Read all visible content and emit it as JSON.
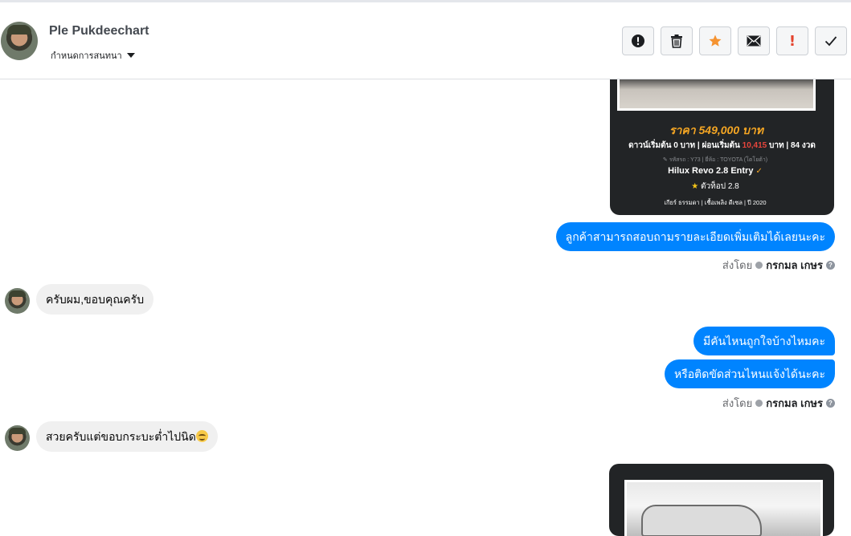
{
  "header": {
    "contact_name": "Ple Pukdeechart",
    "assign_label": "กำหนดการสนทนา",
    "toolbar": [
      {
        "name": "spam-button",
        "icon": "alert-circle-icon"
      },
      {
        "name": "delete-button",
        "icon": "trash-icon"
      },
      {
        "name": "star-button",
        "icon": "star-icon",
        "color": "#f59331"
      },
      {
        "name": "mark-unread-button",
        "icon": "envelope-icon"
      },
      {
        "name": "important-button",
        "icon": "exclamation-icon",
        "glyph": "!",
        "color": "#e4432d"
      },
      {
        "name": "done-button",
        "icon": "checkmark-icon"
      }
    ]
  },
  "car_card": {
    "price": "ราคา 549,000 บาท",
    "down_prefix": "ดาวน์เริ่มต้น 0 บาท | ผ่อนเริ่มต้น",
    "installment": "10,415",
    "down_suffix": "บาท | 84 งวด",
    "meta": "รหัสรถ : Y73 | ยี่ห้อ : TOYOTA (โตโยต้า)",
    "model": "Hilux Revo 2.8 Entry",
    "trim": "ตัวท็อป 2.8",
    "specs": "เกียร์ ธรรมดา  |  เชื้อเพลิง ดีเซล  |  ปี 2020"
  },
  "messages": {
    "out_1": "ลูกค้าสามารถสอบถามรายละเอียดเพิ่มเติมได้เลยนะคะ",
    "in_1": "ครับผม,ขอบคุณครับ",
    "out_2": "มีคันไหนถูกใจบ้างไหมคะ",
    "out_3": "หรือติดขัดส่วนไหนแจ้งได้นะคะ",
    "in_2": "สวยครับแต่ขอบกระบะต่ำไปนิด"
  },
  "sent_by": {
    "label": "ส่งโดย",
    "agent": "กรกมล เกษร",
    "help_glyph": "?"
  },
  "colors": {
    "outgoing_bubble": "#0084ff",
    "incoming_bubble": "#f0f0f0",
    "price": "#f5a623"
  }
}
